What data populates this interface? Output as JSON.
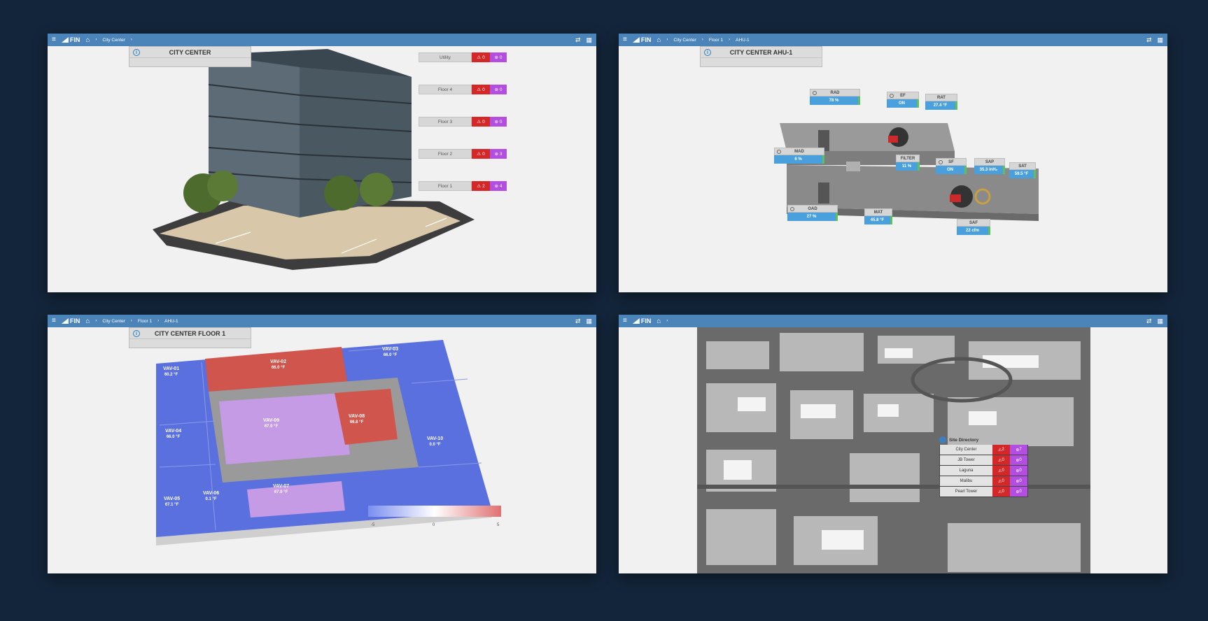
{
  "icons": {
    "menu": "≡",
    "home": "⌂",
    "chevron": "›",
    "refresh": "⇄",
    "grid": "▦",
    "info": "i",
    "alarm": "⚠",
    "event": "⊛"
  },
  "app": {
    "logo_text": "FIN"
  },
  "colors": {
    "topbar": "#4a84b8",
    "alarm": "#d42828",
    "event": "#b24ee0",
    "value": "#4aa0dd",
    "hot": "#d45a50",
    "cold": "#5a6ee0",
    "neutral": "#c99ee8"
  },
  "panel1": {
    "breadcrumb": [
      "City Center"
    ],
    "title": "CITY CENTER",
    "floors": [
      {
        "label": "Utility",
        "alarms": "0",
        "events": "0"
      },
      {
        "label": "Floor 4",
        "alarms": "0",
        "events": "0"
      },
      {
        "label": "Floor 3",
        "alarms": "0",
        "events": "0"
      },
      {
        "label": "Floor 2",
        "alarms": "0",
        "events": "3"
      },
      {
        "label": "Floor 1",
        "alarms": "2",
        "events": "4"
      }
    ]
  },
  "panel2": {
    "breadcrumb": [
      "City Center",
      "Floor 1",
      "AHU-1"
    ],
    "title": "CITY CENTER AHU-1",
    "points": [
      {
        "name": "RAD",
        "value": "78 %"
      },
      {
        "name": "EF",
        "value": "ON"
      },
      {
        "name": "RAT",
        "value": "27.4 °F"
      },
      {
        "name": "MAD",
        "value": "6 %"
      },
      {
        "name": "FILTER",
        "value": "11 %"
      },
      {
        "name": "SF",
        "value": "ON"
      },
      {
        "name": "SAP",
        "value": "35.3 inH₂"
      },
      {
        "name": "SAT",
        "value": "59.5 °F"
      },
      {
        "name": "OAD",
        "value": "27 %"
      },
      {
        "name": "MAT",
        "value": "45.8 °F"
      },
      {
        "name": "SAF",
        "value": "22 cfm"
      }
    ]
  },
  "panel3": {
    "breadcrumb": [
      "City Center",
      "Floor 1",
      "AHU-1"
    ],
    "title": "CITY CENTER FLOOR 1",
    "vavs": [
      {
        "name": "VAV-01",
        "temp": "60.2 °F"
      },
      {
        "name": "VAV-02",
        "temp": "66.0 °F"
      },
      {
        "name": "VAV-03",
        "temp": "66.0 °F"
      },
      {
        "name": "VAV-04",
        "temp": "66.0 °F"
      },
      {
        "name": "VAV-05",
        "temp": "67.1 °F"
      },
      {
        "name": "VAV-06",
        "temp": "0.1 °F"
      },
      {
        "name": "VAV-07",
        "temp": "67.0 °F"
      },
      {
        "name": "VAV-08",
        "temp": "66.8 °F"
      },
      {
        "name": "VAV-09",
        "temp": "67.0 °F"
      },
      {
        "name": "VAV-10",
        "temp": "0.0 °F"
      }
    ],
    "legend": {
      "min": "-5",
      "mid": "0",
      "max": "5"
    }
  },
  "panel4": {
    "breadcrumb": [],
    "site_directory_title": "Site Directory",
    "sites": [
      {
        "name": "City Center",
        "alarms": "2",
        "events": "7"
      },
      {
        "name": "JB Tower",
        "alarms": "0",
        "events": "0"
      },
      {
        "name": "Laguna",
        "alarms": "0",
        "events": "0"
      },
      {
        "name": "Malibu",
        "alarms": "0",
        "events": "0"
      },
      {
        "name": "Pearl Tower",
        "alarms": "0",
        "events": "0"
      }
    ]
  }
}
